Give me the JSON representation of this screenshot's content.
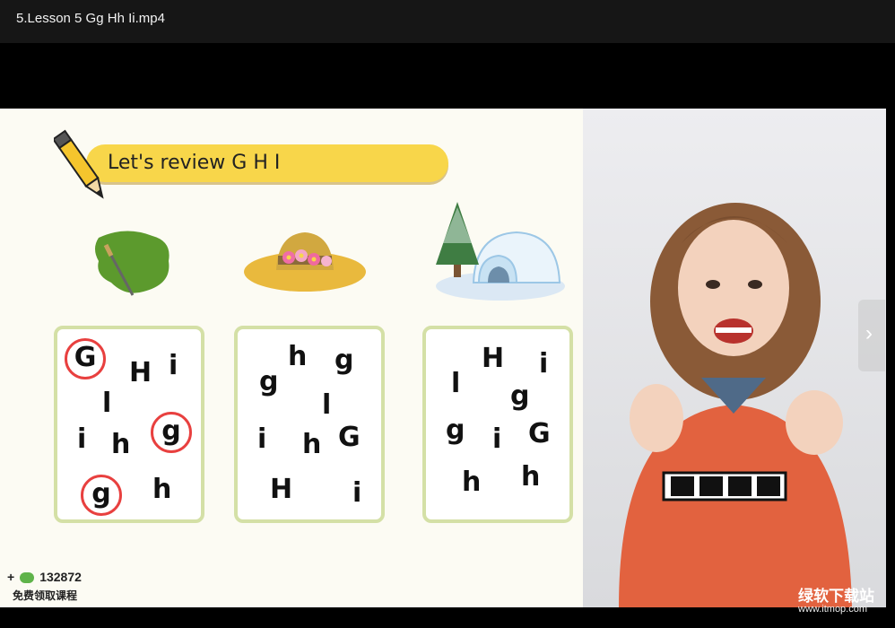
{
  "window": {
    "title": "5.Lesson 5 Gg Hh Ii.mp4"
  },
  "slide": {
    "heading": "Let's review G H I",
    "cards": [
      {
        "letters": [
          "G",
          "H",
          "i",
          "l",
          "i",
          "h",
          "g",
          "g",
          "h"
        ]
      },
      {
        "letters": [
          "g",
          "h",
          "g",
          "l",
          "i",
          "h",
          "G",
          "H",
          "i"
        ]
      },
      {
        "letters": [
          "H",
          "i",
          "l",
          "g",
          "g",
          "i",
          "G",
          "h",
          "h"
        ]
      }
    ],
    "wechat_count": "132872",
    "wechat_sub": "免费领取课程"
  },
  "watermark": {
    "brand": "绿软下载站",
    "url": "www.itmop.com"
  },
  "icons": {
    "pencil": "pencil-icon",
    "grass": "grass-paint-icon",
    "hat": "hat-icon",
    "igloo": "igloo-icon",
    "next": "chevron-right-icon",
    "wechat": "wechat-icon"
  },
  "colors": {
    "banner": "#f8d64a",
    "card_border": "#d4e0a6",
    "circle": "#e8403f"
  }
}
